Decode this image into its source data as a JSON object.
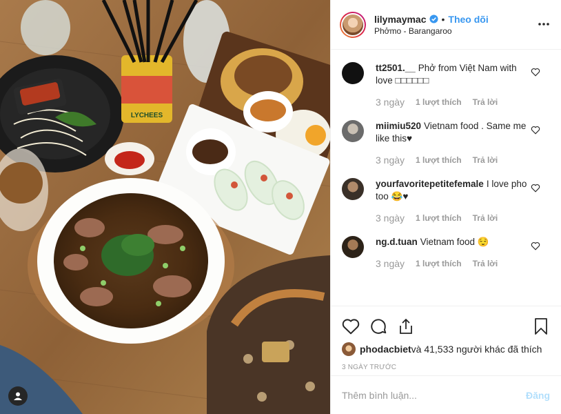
{
  "post": {
    "username": "lilymaymac",
    "separator": "•",
    "follow_label": "Theo dõi",
    "location": "Phởmo - Barangaroo"
  },
  "comments": [
    {
      "user": "tt2501.__",
      "text": "Phở from Việt Nam with love □□□□□□",
      "time": "3 ngày",
      "likes": "1 lượt thích",
      "reply": "Trả lời",
      "avatar_color": "#111111"
    },
    {
      "user": "miimiu520",
      "text": "Vietnam food . Same me like this♥",
      "time": "3 ngày",
      "likes": "1 lượt thích",
      "reply": "Trả lời",
      "avatar_color": "#6b6b6b"
    },
    {
      "user": "yourfavoritepetitefemale",
      "text": "I love pho too 😂♥",
      "time": "3 ngày",
      "likes": "1 lượt thích",
      "reply": "Trả lời",
      "avatar_color": "#3a3028"
    },
    {
      "user": "ng.d.tuan",
      "text": "Vietnam food 😌",
      "time": "3 ngày",
      "likes": "1 lượt thích",
      "reply": "Trả lời",
      "avatar_color": "#2c2218"
    }
  ],
  "likes": {
    "first_user": "phodacbiet",
    "rest_text": " và 41,533 người khác đã thích"
  },
  "time_ago": "3 NGÀY TRƯỚC",
  "comment_box": {
    "placeholder": "Thêm bình luận...",
    "post_label": "Đăng"
  },
  "photo": {
    "can_label": "LYCHEES"
  },
  "colors": {
    "accent": "#3897f0",
    "muted": "#999999",
    "border": "#efefef",
    "post_disabled": "#b2dffc"
  }
}
